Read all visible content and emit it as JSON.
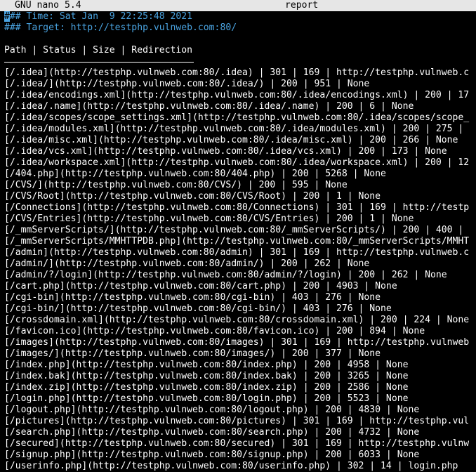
{
  "titlebar": {
    "app": "GNU nano 5.4",
    "filename": "report"
  },
  "header": {
    "cursor_char": "#",
    "time_line": "## Time: Sat Jan  9 22:25:48 2021",
    "target_line": "### Target: http://testphp.vulnweb.com:80/"
  },
  "table": {
    "header_line": "Path | Status | Size | Redirection",
    "rows": [
      "[/.idea](http://testphp.vulnweb.com:80/.idea) | 301 | 169 | http://testphp.vulnweb.c",
      "[/.idea/](http://testphp.vulnweb.com:80/.idea/) | 200 | 951 | None",
      "[/.idea/encodings.xml](http://testphp.vulnweb.com:80/.idea/encodings.xml) | 200 | 17",
      "[/.idea/.name](http://testphp.vulnweb.com:80/.idea/.name) | 200 | 6 | None",
      "[/.idea/scopes/scope_settings.xml](http://testphp.vulnweb.com:80/.idea/scopes/scope_",
      "[/.idea/modules.xml](http://testphp.vulnweb.com:80/.idea/modules.xml) | 200 | 275 |",
      "[/.idea/misc.xml](http://testphp.vulnweb.com:80/.idea/misc.xml) | 200 | 266 | None",
      "[/.idea/vcs.xml](http://testphp.vulnweb.com:80/.idea/vcs.xml) | 200 | 173 | None",
      "[/.idea/workspace.xml](http://testphp.vulnweb.com:80/.idea/workspace.xml) | 200 | 12",
      "[/404.php](http://testphp.vulnweb.com:80/404.php) | 200 | 5268 | None",
      "[/CVS/](http://testphp.vulnweb.com:80/CVS/) | 200 | 595 | None",
      "[/CVS/Root](http://testphp.vulnweb.com:80/CVS/Root) | 200 | 1 | None",
      "[/Connections](http://testphp.vulnweb.com:80/Connections) | 301 | 169 | http://testp",
      "[/CVS/Entries](http://testphp.vulnweb.com:80/CVS/Entries) | 200 | 1 | None",
      "[/_mmServerScripts/](http://testphp.vulnweb.com:80/_mmServerScripts/) | 200 | 400 |",
      "[/_mmServerScripts/MMHTTPDB.php](http://testphp.vulnweb.com:80/_mmServerScripts/MMHT",
      "[/admin](http://testphp.vulnweb.com:80/admin) | 301 | 169 | http://testphp.vulnweb.c",
      "[/admin/](http://testphp.vulnweb.com:80/admin/) | 200 | 262 | None",
      "[/admin/?/login](http://testphp.vulnweb.com:80/admin/?/login) | 200 | 262 | None",
      "[/cart.php](http://testphp.vulnweb.com:80/cart.php) | 200 | 4903 | None",
      "[/cgi-bin](http://testphp.vulnweb.com:80/cgi-bin) | 403 | 276 | None",
      "[/cgi-bin/](http://testphp.vulnweb.com:80/cgi-bin/) | 403 | 276 | None",
      "[/crossdomain.xml](http://testphp.vulnweb.com:80/crossdomain.xml) | 200 | 224 | None",
      "[/favicon.ico](http://testphp.vulnweb.com:80/favicon.ico) | 200 | 894 | None",
      "[/images](http://testphp.vulnweb.com:80/images) | 301 | 169 | http://testphp.vulnweb",
      "[/images/](http://testphp.vulnweb.com:80/images/) | 200 | 377 | None",
      "[/index.php](http://testphp.vulnweb.com:80/index.php) | 200 | 4958 | None",
      "[/index.bak](http://testphp.vulnweb.com:80/index.bak) | 200 | 3265 | None",
      "[/index.zip](http://testphp.vulnweb.com:80/index.zip) | 200 | 2586 | None",
      "[/login.php](http://testphp.vulnweb.com:80/login.php) | 200 | 5523 | None",
      "[/logout.php](http://testphp.vulnweb.com:80/logout.php) | 200 | 4830 | None",
      "[/pictures](http://testphp.vulnweb.com:80/pictures) | 301 | 169 | http://testphp.vul",
      "[/search.php](http://testphp.vulnweb.com:80/search.php) | 200 | 4732 | None",
      "[/secured](http://testphp.vulnweb.com:80/secured) | 301 | 169 | http://testphp.vulnw",
      "[/signup.php](http://testphp.vulnweb.com:80/signup.php) | 200 | 6033 | None",
      "[/userinfo.php](http://testphp.vulnweb.com:80/userinfo.php) | 302 | 14 | login.php"
    ]
  },
  "colors": {
    "titlebar_bg": "#e6e6e6",
    "editor_bg": "#000000",
    "text": "#ffffff",
    "comment": "#4aa3e0"
  }
}
